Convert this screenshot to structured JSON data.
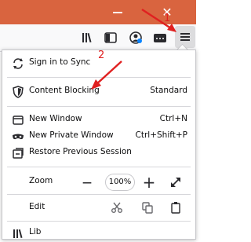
{
  "annotations": {
    "step1": "1",
    "step2": "2"
  },
  "menu": {
    "sync": {
      "label": "Sign in to Sync"
    },
    "content_blocking": {
      "label": "Content Blocking",
      "value": "Standard"
    },
    "new_window": {
      "label": "New Window",
      "shortcut": "Ctrl+N"
    },
    "private_window": {
      "label": "New Private Window",
      "shortcut": "Ctrl+Shift+P"
    },
    "restore": {
      "label": "Restore Previous Session"
    },
    "zoom": {
      "label": "Zoom",
      "minus": "—",
      "value": "100%",
      "plus": "+"
    },
    "edit": {
      "label": "Edit"
    },
    "partial_next": {
      "label": "Lib"
    }
  },
  "colors": {
    "titlebar": "#d9643f",
    "annotation": "#e02020"
  }
}
